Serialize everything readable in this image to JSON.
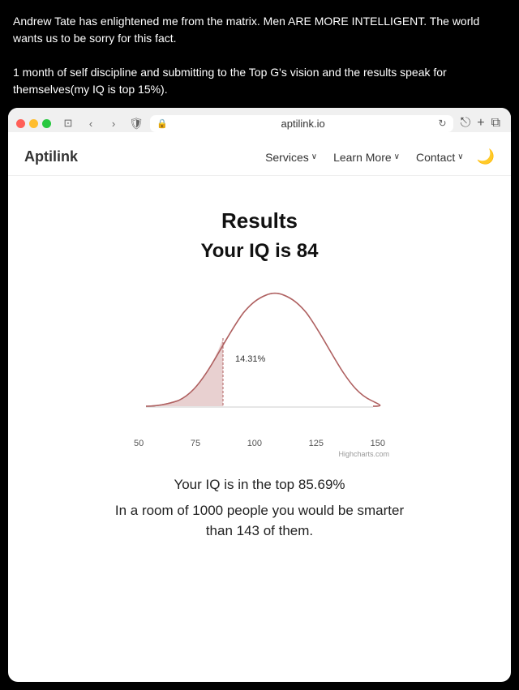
{
  "context": {
    "line1": "Andrew Tate has enlightened me from the matrix. Men ARE MORE INTELLIGENT. The world wants us to be sorry for this fact.",
    "line2": "1 month of self discipline and submitting to the Top G's vision and the results speak for themselves(my IQ is top 15%)."
  },
  "browser": {
    "url": "aptilink.io",
    "back_label": "<",
    "forward_label": ">",
    "share_label": "⎋",
    "add_label": "+",
    "tabs_label": "⧉"
  },
  "nav": {
    "logo": "Aptilink",
    "items": [
      {
        "label": "Services",
        "has_dropdown": true
      },
      {
        "label": "Learn More",
        "has_dropdown": true
      },
      {
        "label": "Contact",
        "has_dropdown": true
      }
    ],
    "dark_mode_icon": "🌙"
  },
  "results": {
    "title": "Results",
    "iq_label": "Your IQ is 84",
    "chart": {
      "percentage_label": "14.31%",
      "axis_labels": [
        "50",
        "75",
        "100",
        "125",
        "150"
      ],
      "credit": "Highcharts.com"
    },
    "stat1": "Your IQ is in the top 85.69%",
    "stat2": "In a room of 1000 people you would be smarter than 143 of them."
  }
}
